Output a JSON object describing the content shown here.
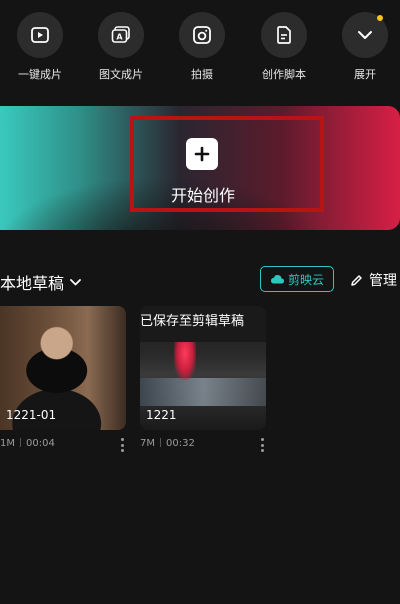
{
  "toolbar": {
    "items": [
      {
        "label": "一键成片",
        "icon": "play-square-icon"
      },
      {
        "label": "图文成片",
        "icon": "text-to-video-icon"
      },
      {
        "label": "拍摄",
        "icon": "camera-icon"
      },
      {
        "label": "创作脚本",
        "icon": "script-document-icon"
      },
      {
        "label": "展开",
        "icon": "chevron-down-icon"
      }
    ]
  },
  "create": {
    "label": "开始创作",
    "icon": "plus-icon"
  },
  "drafts": {
    "title": "本地草稿",
    "cloud_label": "剪映云",
    "manage_label": "管理",
    "items": [
      {
        "caption": "1221-01",
        "size": "1M",
        "duration": "00:04"
      },
      {
        "overlay": "已保存至剪辑草稿",
        "caption": "1221",
        "size": "7M",
        "duration": "00:32"
      }
    ]
  },
  "colors": {
    "background": "#141414",
    "accent_teal": "#2fc6bd",
    "highlight_red": "#b81414",
    "notification_dot": "#f5c518"
  }
}
